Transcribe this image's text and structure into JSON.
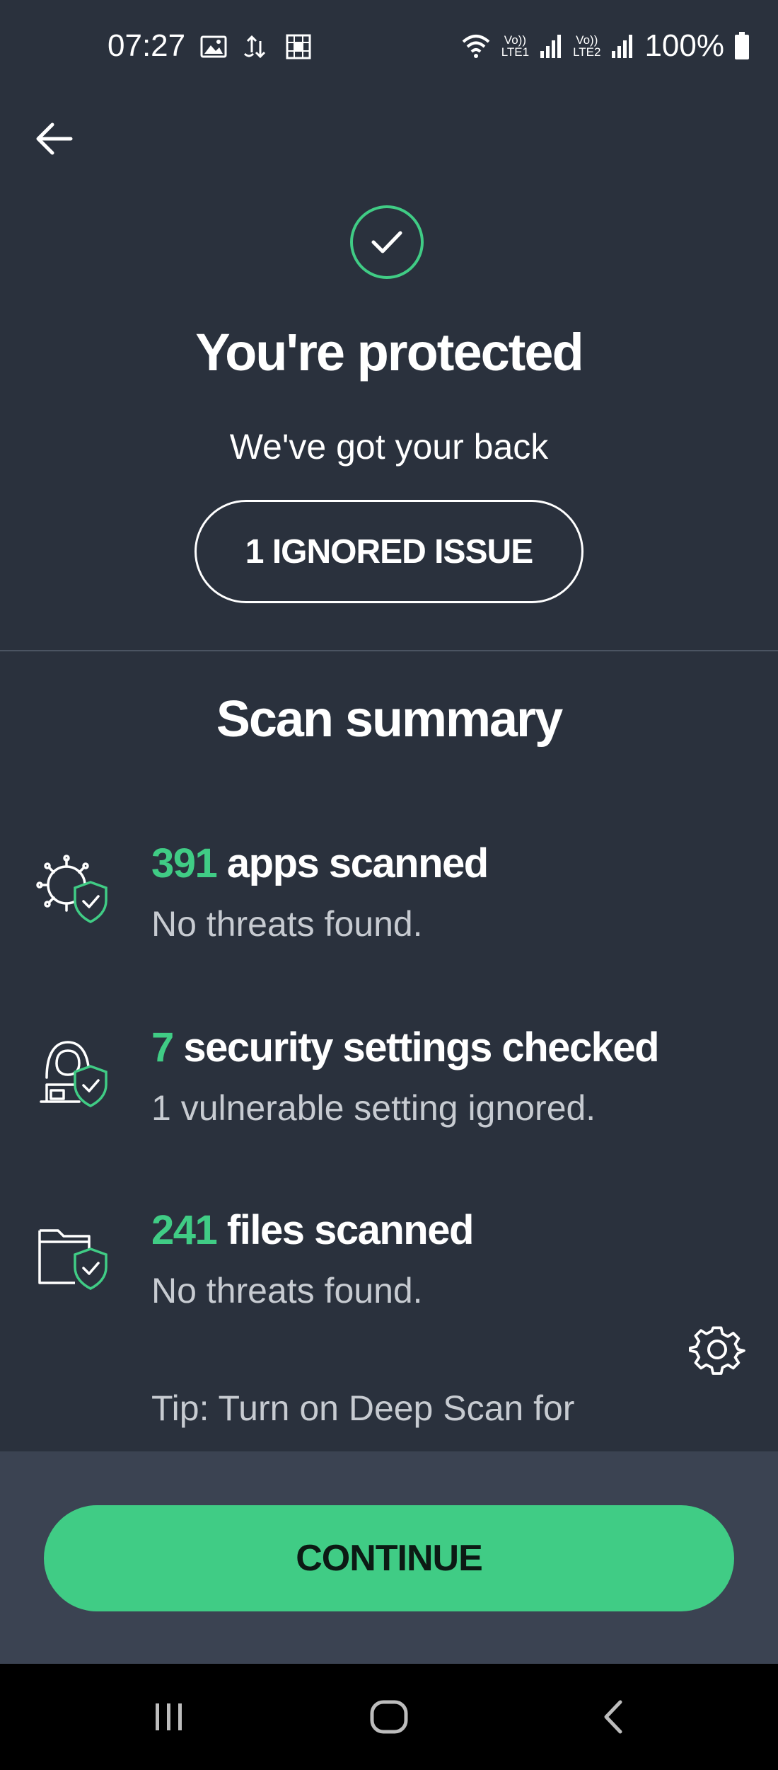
{
  "status_bar": {
    "time": "07:27",
    "sim1_label_top": "Vo))",
    "sim1_label_bottom": "LTE1",
    "sim2_label_top": "Vo))",
    "sim2_label_bottom": "LTE2",
    "battery_percent": "100%"
  },
  "header": {
    "title": "You're protected",
    "subtitle": "We've got your back",
    "ignored_button_label": "1 IGNORED ISSUE"
  },
  "summary": {
    "title": "Scan summary",
    "items": [
      {
        "icon": "apps-virus-shield-icon",
        "count": "391",
        "label": " apps scanned",
        "detail": "No threats found."
      },
      {
        "icon": "hacker-shield-icon",
        "count": "7",
        "label": " security settings checked",
        "detail": "1 vulnerable setting ignored."
      },
      {
        "icon": "folder-shield-icon",
        "count": "241",
        "label": " files scanned",
        "detail": "No threats found."
      }
    ],
    "tip": "Tip: Turn on Deep Scan for"
  },
  "actions": {
    "continue_label": "CONTINUE"
  },
  "colors": {
    "background": "#2a313d",
    "accent": "#40cc85",
    "bottom_panel": "#3b4352"
  }
}
